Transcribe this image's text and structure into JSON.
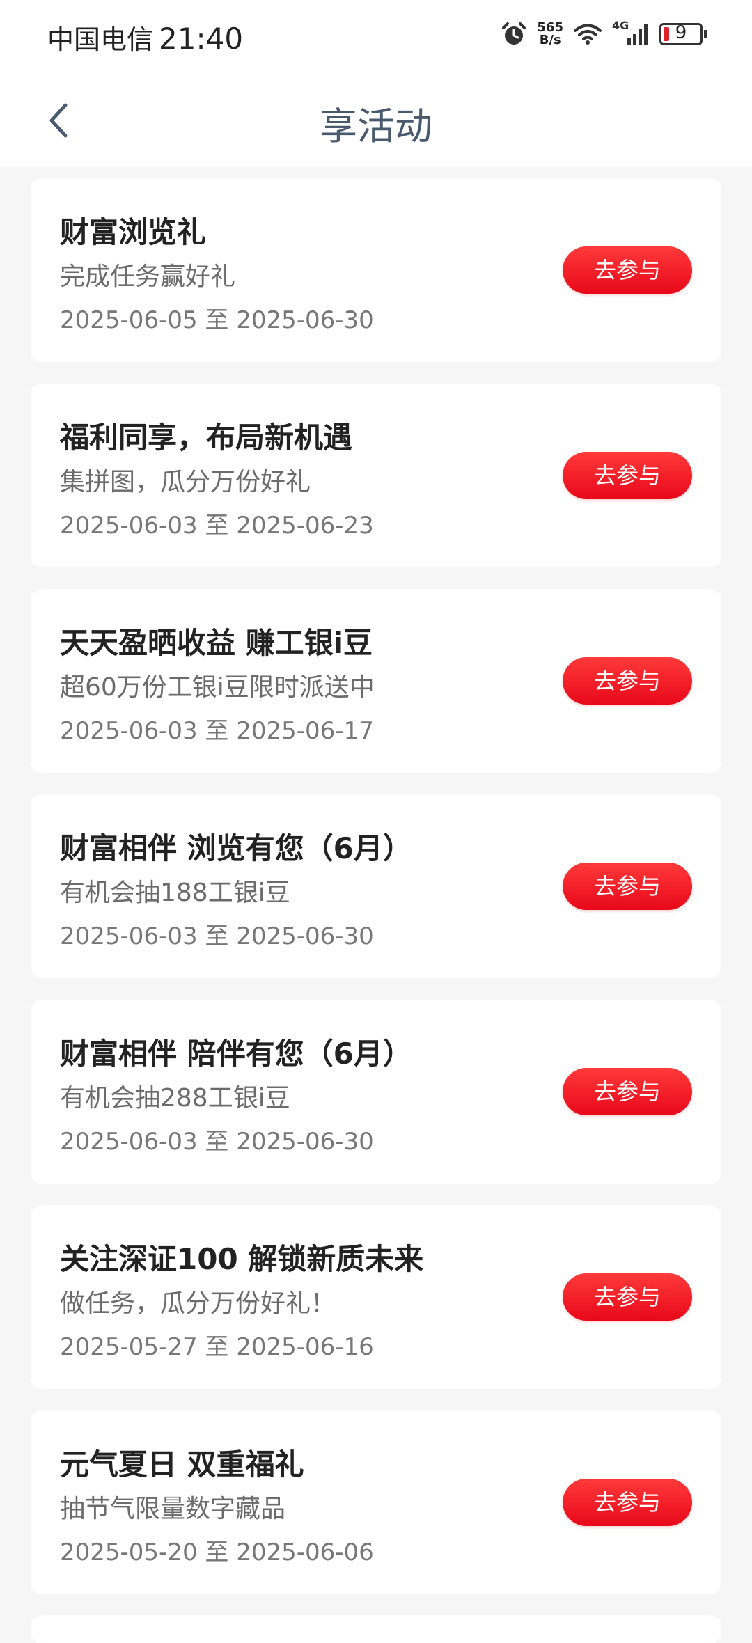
{
  "status_bar": {
    "carrier": "中国电信",
    "time": "21:40",
    "network_speed_value": "565",
    "network_speed_unit": "B/s",
    "network_type": "4G",
    "battery_level": "9",
    "battery_color": "#e0232b"
  },
  "nav": {
    "title": "享活动"
  },
  "activities": [
    {
      "title": "财富浏览礼",
      "subtitle": "完成任务赢好礼",
      "dates": "2025-06-05 至 2025-06-30",
      "button": "去参与"
    },
    {
      "title": "福利同享，布局新机遇",
      "subtitle": "集拼图，瓜分万份好礼",
      "dates": "2025-06-03 至 2025-06-23",
      "button": "去参与"
    },
    {
      "title": "天天盈晒收益 赚工银i豆",
      "subtitle": "超60万份工银i豆限时派送中",
      "dates": "2025-06-03 至 2025-06-17",
      "button": "去参与"
    },
    {
      "title": "财富相伴 浏览有您（6月）",
      "subtitle": "有机会抽188工银i豆",
      "dates": "2025-06-03 至 2025-06-30",
      "button": "去参与"
    },
    {
      "title": "财富相伴 陪伴有您（6月）",
      "subtitle": "有机会抽288工银i豆",
      "dates": "2025-06-03 至 2025-06-30",
      "button": "去参与"
    },
    {
      "title": "关注深证100 解锁新质未来",
      "subtitle": "做任务，瓜分万份好礼！",
      "dates": "2025-05-27 至 2025-06-16",
      "button": "去参与"
    },
    {
      "title": "元气夏日 双重福礼",
      "subtitle": "抽节气限量数字藏品",
      "dates": "2025-05-20 至 2025-06-06",
      "button": "去参与"
    }
  ],
  "colors": {
    "accent_button": "#e8081a",
    "page_background": "#f6f6f6",
    "title_color": "#4a5a6e"
  }
}
